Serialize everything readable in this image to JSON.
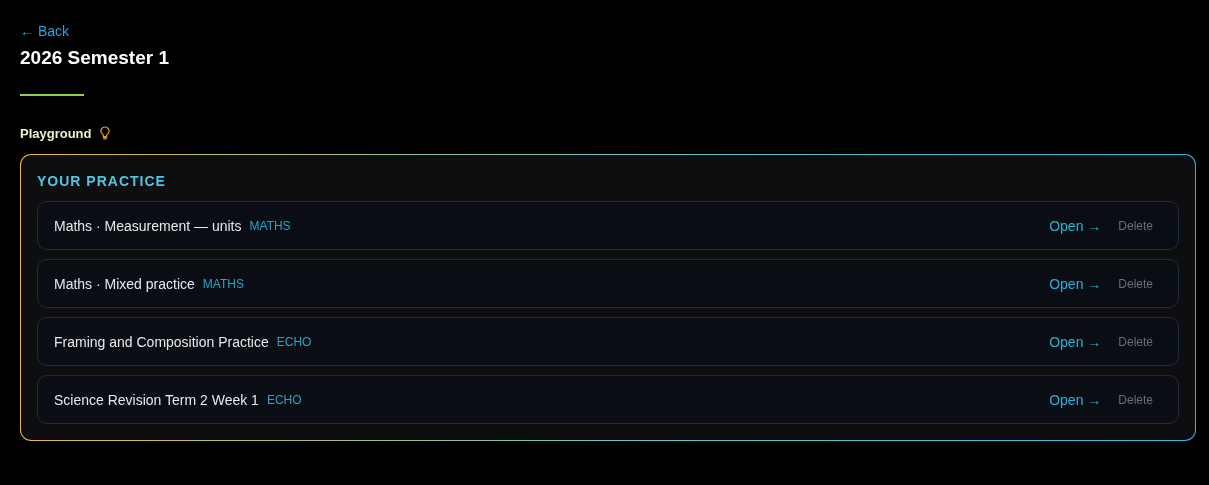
{
  "back_link": "← Back",
  "title": "2026 Semester 1",
  "section_label": "Playground",
  "practice_panel": {
    "heading": "YOUR PRACTICE",
    "items": [
      {
        "title": "Maths · Measurement — units",
        "tag": "MATHS",
        "open": "Open →",
        "delete": "Delete"
      },
      {
        "title": "Maths · Mixed practice",
        "tag": "MATHS",
        "open": "Open →",
        "delete": "Delete"
      },
      {
        "title": "Framing and Composition Practice",
        "tag": "ECHO",
        "open": "Open →",
        "delete": "Delete"
      },
      {
        "title": "Science Revision Term 2 Week 1",
        "tag": "ECHO",
        "open": "Open →",
        "delete": "Delete"
      }
    ]
  }
}
